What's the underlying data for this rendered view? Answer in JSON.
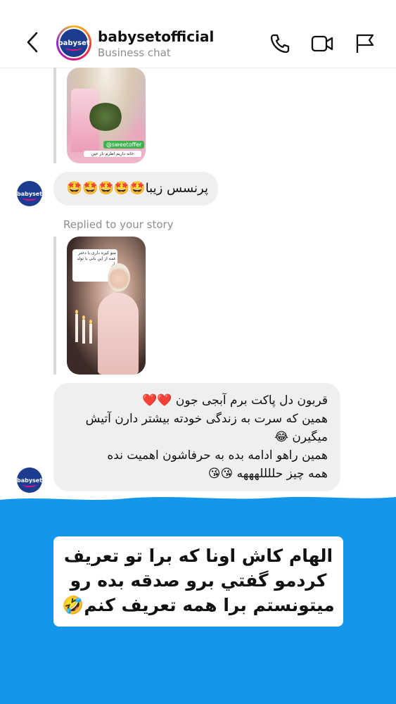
{
  "header": {
    "account_name": "babysetofficial",
    "subtitle": "Business chat",
    "avatar_text": "babyset"
  },
  "messages": {
    "story1_tag": "@sweetoffer",
    "story1_caption": "خانه داریم اطرم ناز عین عکسش",
    "reaction_bubble": "پرنسس زیبا🤩🤩🤩🤩🤩",
    "replied_label": "Replied to your story",
    "story2_note": "منو کیزه داری با دختر عمه از این بانی با تولد پار",
    "reply_lines": [
      "قربون دل پاکت برم آبجی جون ❤️❤️",
      "همین که سرت به زندگی خودته بیشتر دارن آتیش",
      "میگیرن 😂",
      "همین راهو ادامه بده به حرفاشون اهمیت نده",
      "همه چیز حللللهههه 😘😘"
    ]
  },
  "overlay": {
    "background_color": "#1497ea",
    "caption_lines": [
      "الهام کاش اونا که برا تو تعریف",
      "کردمو گفتي برو صدقه بده رو",
      "میتونستم برا همه تعریف کنم🤣"
    ]
  },
  "icons": [
    "back-arrow-icon",
    "phone-icon",
    "video-camera-icon",
    "flag-icon"
  ]
}
